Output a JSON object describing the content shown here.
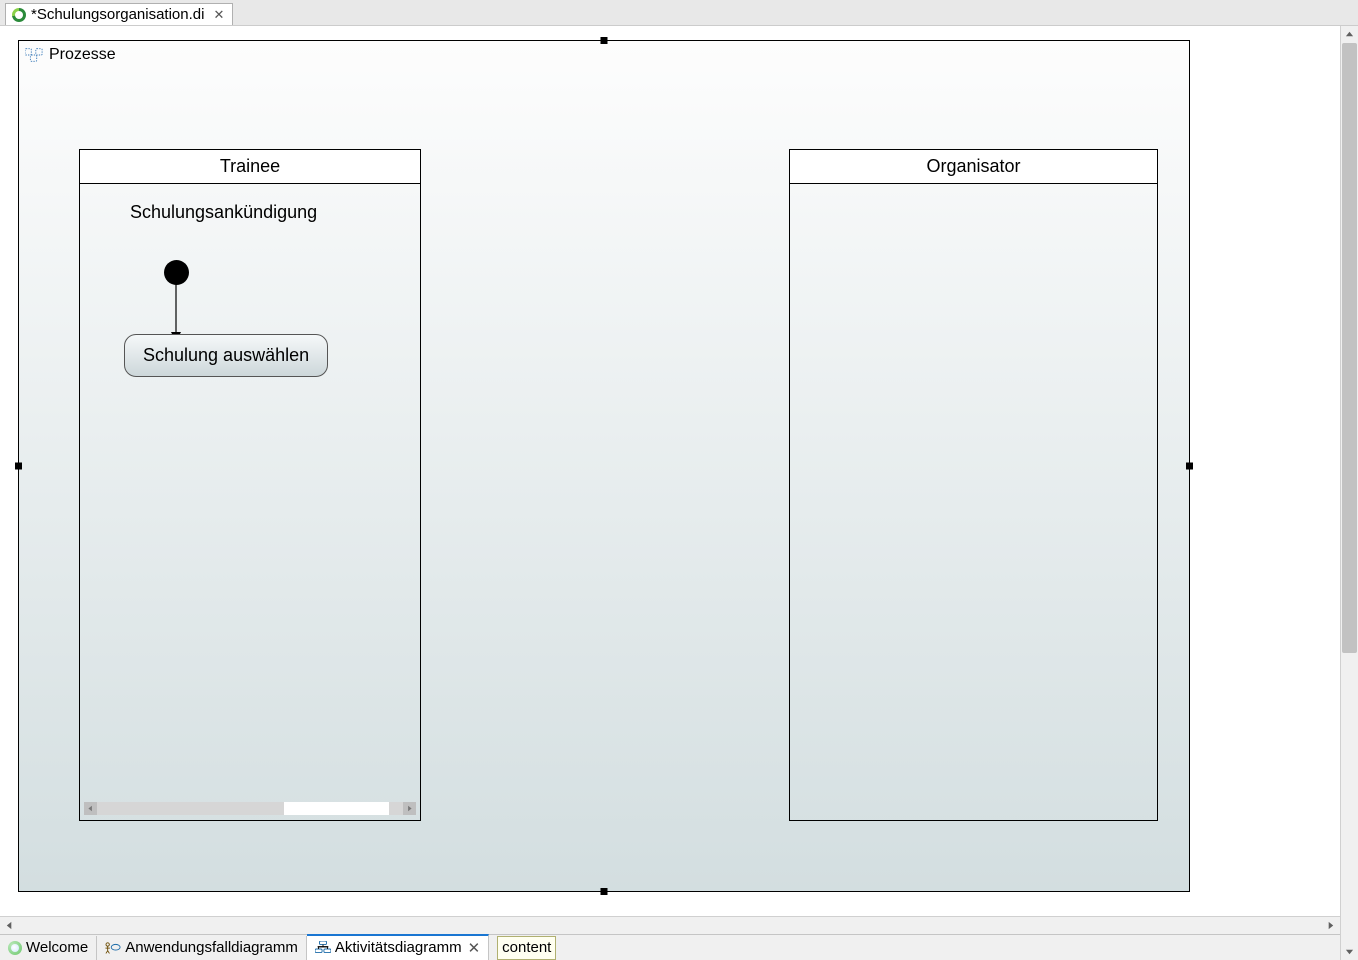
{
  "file_tab": {
    "title": "*Schulungsorganisation.di"
  },
  "diagram": {
    "frame_title": "Prozesse",
    "swimlanes": {
      "trainee": {
        "title": "Trainee",
        "signal_label": "Schulungsankündigung",
        "activity_label": "Schulung auswählen"
      },
      "organisator": {
        "title": "Organisator"
      }
    }
  },
  "bottom_tabs": {
    "welcome": "Welcome",
    "usecase": "Anwendungsfalldiagramm",
    "activity": "Aktivitätsdiagramm",
    "content": "content"
  },
  "chart_data": {
    "type": "uml-activity-diagram",
    "frame": "Prozesse",
    "swimlanes": [
      {
        "name": "Trainee",
        "elements": [
          {
            "type": "input-signal",
            "label": "Schulungsankündigung"
          },
          {
            "type": "initial-node"
          },
          {
            "type": "action",
            "label": "Schulung auswählen"
          }
        ],
        "flows": [
          {
            "from": "initial-node",
            "to": "Schulung auswählen"
          }
        ]
      },
      {
        "name": "Organisator",
        "elements": [],
        "flows": []
      }
    ]
  }
}
